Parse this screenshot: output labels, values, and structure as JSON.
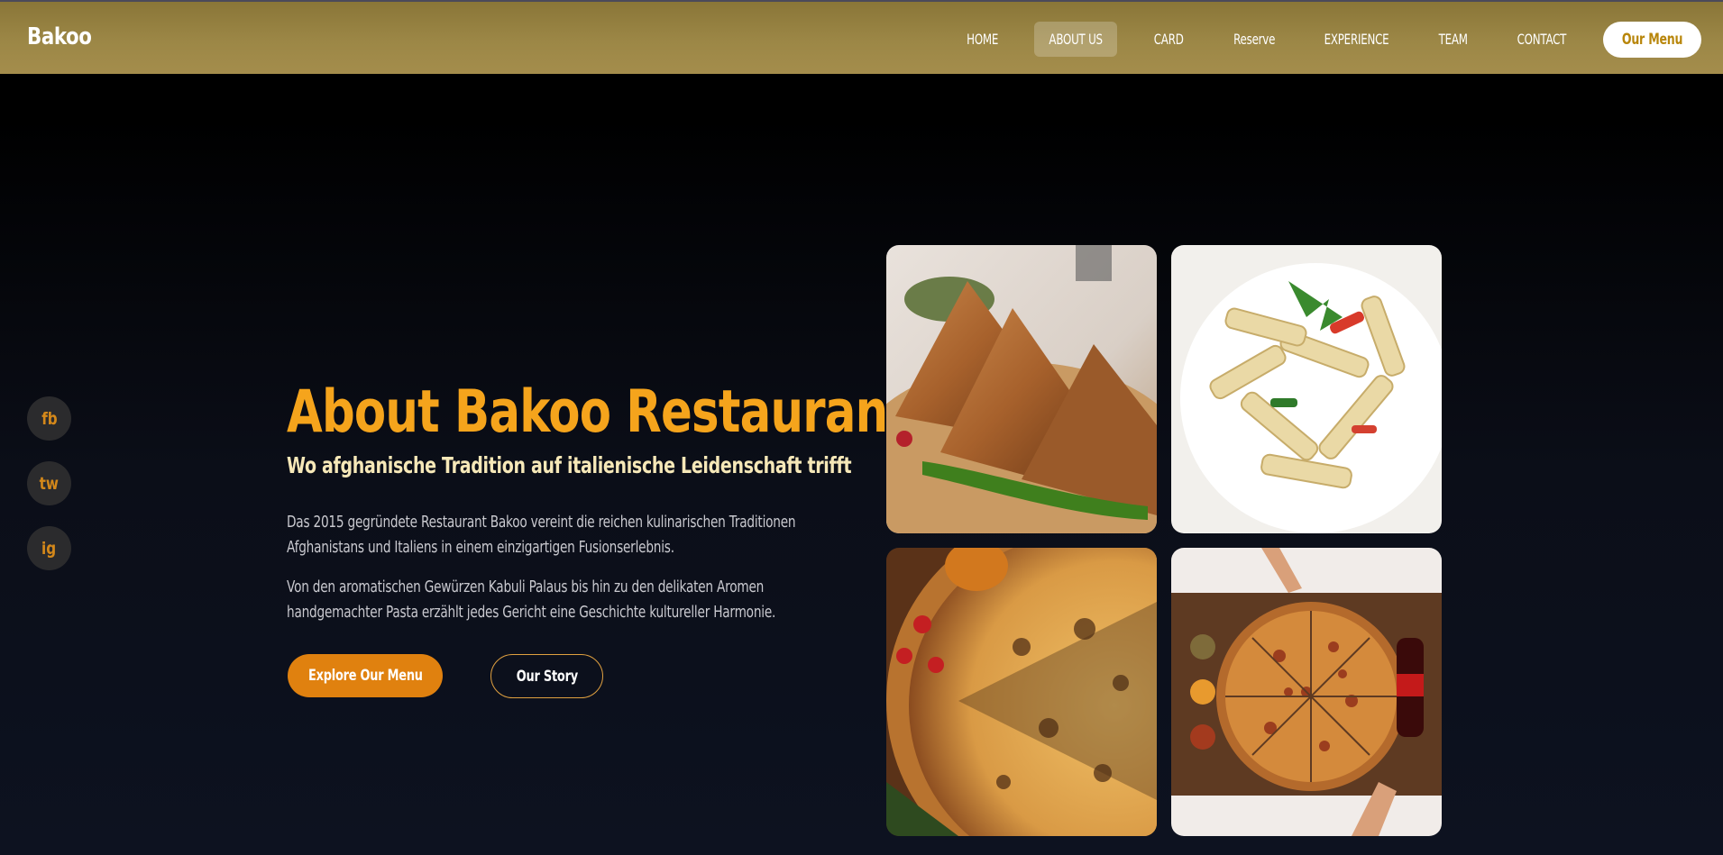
{
  "header": {
    "logo": "Bakoo",
    "nav": [
      {
        "label": "HOME",
        "active": false
      },
      {
        "label": "ABOUT US",
        "active": true
      },
      {
        "label": "CARD",
        "active": false
      },
      {
        "label": "Reserve",
        "active": false
      },
      {
        "label": "EXPERIENCE",
        "active": false
      },
      {
        "label": "TEAM",
        "active": false
      },
      {
        "label": "CONTACT",
        "active": false
      }
    ],
    "cta": "Our Menu"
  },
  "social": [
    {
      "label": "fb",
      "icon": "facebook-icon"
    },
    {
      "label": "tw",
      "icon": "twitter-icon"
    },
    {
      "label": "ig",
      "icon": "instagram-icon"
    }
  ],
  "hero": {
    "title": "About Bakoo Restaurant",
    "subtitle": "Wo afghanische Tradition auf italienische Leidenschaft trifft",
    "paragraphs": [
      "Das 2015 gegründete Restaurant Bakoo vereint die reichen kulinarischen Traditionen Afghanistans und Italiens in einem einzigartigen Fusionserlebnis.",
      "Von den aromatischen Gewürzen Kabuli Palaus bis hin zu den delikaten Aromen handgemachter Pasta erzählt jedes Gericht eine Geschichte kultureller Harmonie."
    ],
    "primary_button": "Explore Our Menu",
    "secondary_button": "Our Story"
  },
  "gallery": [
    {
      "name": "samosa-photo"
    },
    {
      "name": "penne-pasta-photo"
    },
    {
      "name": "pizza-closeup-photo"
    },
    {
      "name": "pizza-sharing-photo"
    }
  ],
  "colors": {
    "accent": "#f5a41c",
    "button": "#e0810f",
    "header": "#9c8746",
    "background": "#0b0e18"
  }
}
